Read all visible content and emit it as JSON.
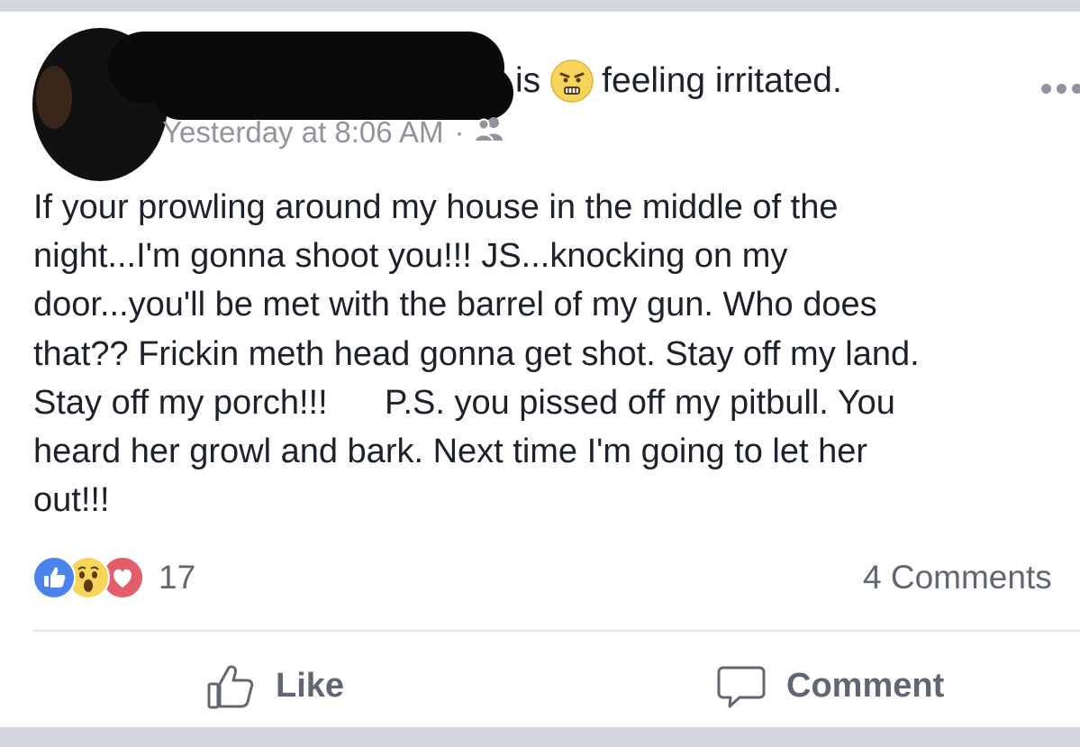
{
  "post": {
    "activity_verb": "is",
    "feeling_text": "feeling irritated.",
    "timestamp": "Yesterday at 8:06 AM",
    "separator": "·",
    "privacy_icon": "friends-icon",
    "body": "If your prowling around my house in the middle of the\nnight...I'm gonna shoot you!!! JS...knocking on my\ndoor...you'll be met with the barrel of my gun. Who does\nthat?? Frickin meth head gonna get shot. Stay off my land.\nStay off my porch!!!      P.S. you pissed off my pitbull. You\nheard her growl and bark. Next time I'm going to let her\nout!!!"
  },
  "reactions": {
    "count": "17",
    "icons": [
      "like-reaction-icon",
      "wow-reaction-icon",
      "love-reaction-icon"
    ],
    "colors": {
      "like": "#4a83ec",
      "wow": "#f7d55a",
      "love": "#e35d6a"
    }
  },
  "comments": {
    "count_label": "4 Comments"
  },
  "actions": {
    "like_label": "Like",
    "comment_label": "Comment"
  },
  "colors": {
    "text": "#1d2129",
    "meta": "#90949c",
    "action": "#606770",
    "background": "#d3d6db"
  }
}
